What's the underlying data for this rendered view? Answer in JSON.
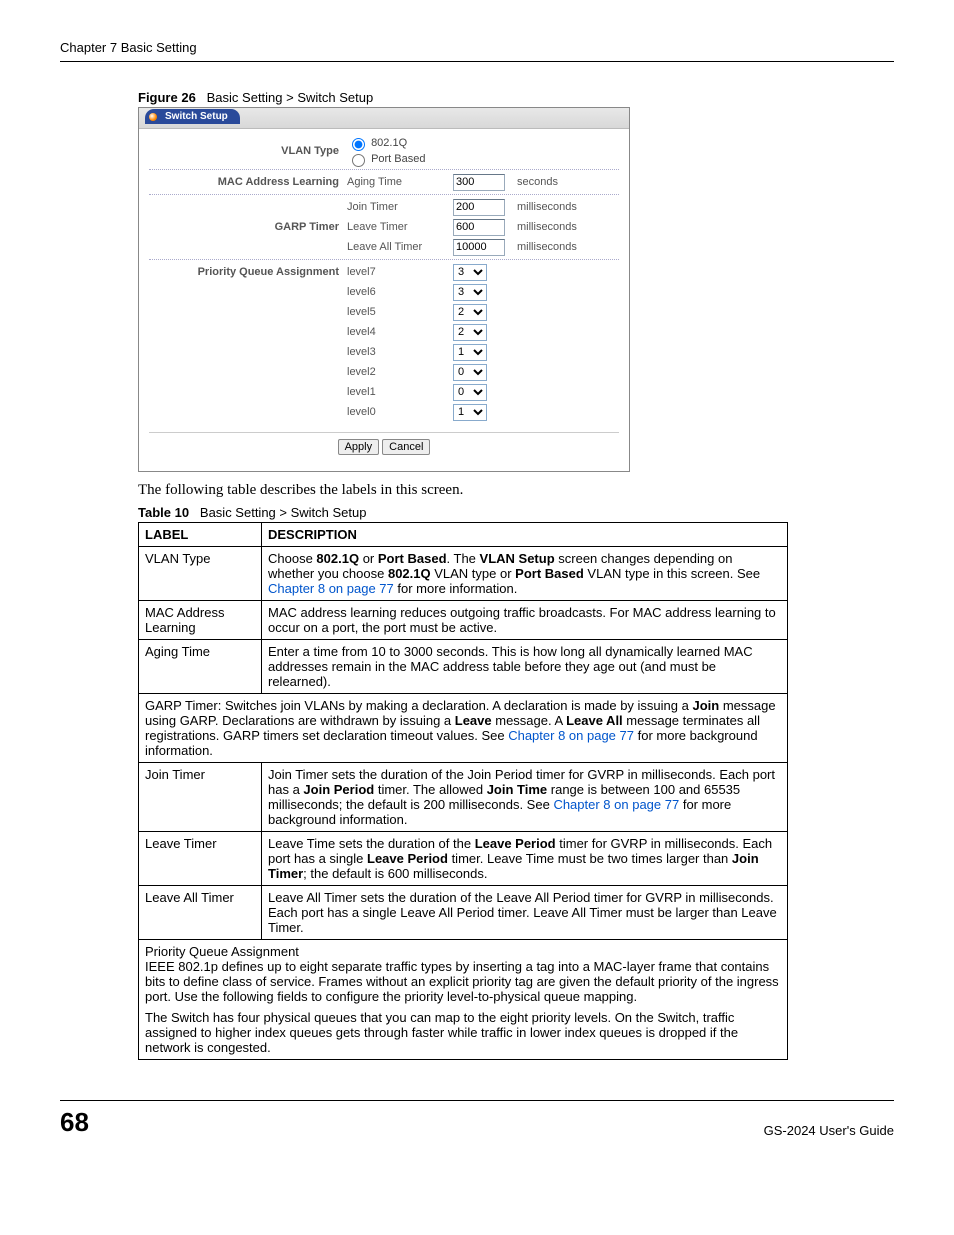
{
  "chapter": "Chapter 7 Basic Setting",
  "figure_label": "Figure 26",
  "figure_title": "Basic Setting > Switch Setup",
  "screenshot": {
    "tab": "Switch Setup",
    "vlan_type_label": "VLAN Type",
    "vlan_opt1": "802.1Q",
    "vlan_opt2": "Port Based",
    "mac_learning_label": "MAC Address Learning",
    "aging_time_label": "Aging Time",
    "aging_time_value": "300",
    "seconds": "seconds",
    "garp_timer_label": "GARP Timer",
    "join_timer_label": "Join Timer",
    "join_timer_value": "200",
    "leave_timer_label": "Leave Timer",
    "leave_timer_value": "600",
    "leave_all_timer_label": "Leave All Timer",
    "leave_all_timer_value": "10000",
    "ms": "milliseconds",
    "pqa_label": "Priority Queue Assignment",
    "levels": [
      "level7",
      "level6",
      "level5",
      "level4",
      "level3",
      "level2",
      "level1",
      "level0"
    ],
    "level_vals": [
      "3",
      "3",
      "2",
      "2",
      "1",
      "0",
      "0",
      "1"
    ],
    "apply": "Apply",
    "cancel": "Cancel"
  },
  "body_text": "The following table describes the labels in this screen.",
  "table_label": "Table 10",
  "table_title": "Basic Setting > Switch Setup",
  "th_label": "LABEL",
  "th_desc": "DESCRIPTION",
  "rows": {
    "r1l": "VLAN Type",
    "r1d_a": "Choose ",
    "r1d_b": "802.1Q",
    "r1d_c": " or ",
    "r1d_d": "Port Based",
    "r1d_e": ". The ",
    "r1d_f": "VLAN Setup",
    "r1d_g": " screen changes depending on whether you choose ",
    "r1d_h": "802.1Q",
    "r1d_i": " VLAN type or ",
    "r1d_j": "Port Based",
    "r1d_k": " VLAN type in this screen. See ",
    "r1d_l": "Chapter 8 on page 77",
    "r1d_m": " for more information.",
    "r2l": "MAC Address Learning",
    "r2d": "MAC address learning reduces outgoing traffic broadcasts. For MAC address learning to occur on a port, the port must be active.",
    "r3l": "Aging Time",
    "r3d": "Enter a time from 10 to 3000 seconds. This is how long all dynamically learned MAC addresses remain in the MAC address table before they age out (and must be relearned).",
    "r4a": "GARP Timer: Switches join VLANs by making a declaration. A declaration is made by issuing a ",
    "r4b": "Join",
    "r4c": " message using GARP. Declarations are withdrawn by issuing a ",
    "r4d": "Leave",
    "r4e": " message. A ",
    "r4f": "Leave All",
    "r4g": " message terminates all registrations. GARP timers set declaration timeout values. See ",
    "r4h": "Chapter 8 on page 77",
    "r4i": " for more background information.",
    "r5l": "Join Timer",
    "r5a": "Join Timer sets the duration of the Join Period timer for GVRP in milliseconds. Each port has a ",
    "r5b": "Join Period",
    "r5c": " timer. The allowed ",
    "r5d": "Join Time",
    "r5e": " range is between 100 and 65535 milliseconds; the default is 200 milliseconds. See ",
    "r5f": "Chapter 8 on page 77",
    "r5g": " for more background information.",
    "r6l": "Leave Timer",
    "r6a": "Leave Time sets the duration of the ",
    "r6b": "Leave Period",
    "r6c": " timer for GVRP in milliseconds. Each port has a single ",
    "r6d": "Leave Period",
    "r6e": " timer. Leave Time must be two times larger than ",
    "r6f": "Join Timer",
    "r6g": "; the default is 600 milliseconds.",
    "r7l": "Leave All Timer",
    "r7d": "Leave All Timer sets the duration of the Leave All Period timer for GVRP in milliseconds. Each port has a single Leave All Period timer. Leave All Timer must be larger than Leave Timer.",
    "r8a": "Priority Queue Assignment",
    "r8b": "IEEE 802.1p defines up to eight separate traffic types by inserting a tag into a MAC-layer frame that contains bits to define class of service. Frames without an explicit priority tag are given the default priority of the ingress port. Use the following fields to configure the priority level-to-physical queue mapping.",
    "r8c": "The Switch has four physical queues that you can map to the eight priority levels. On the Switch, traffic assigned to higher index queues gets through faster while traffic in lower index queues is dropped if the network is congested."
  },
  "page_number": "68",
  "guide": "GS-2024 User's Guide"
}
